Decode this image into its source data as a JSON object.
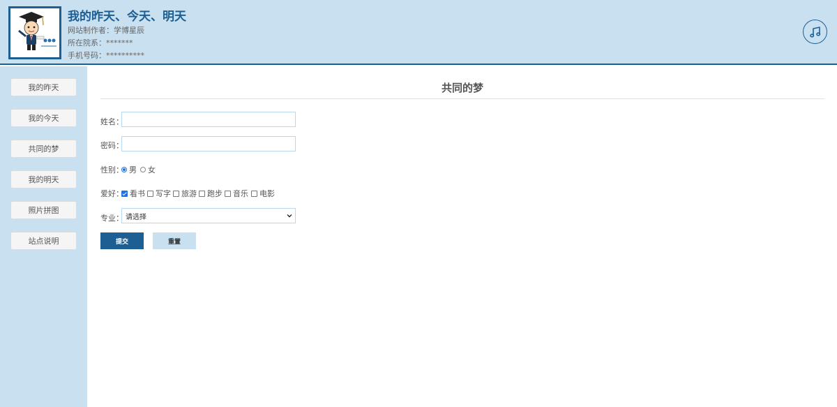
{
  "header": {
    "title": "我的昨天、今天、明天",
    "author": "网站制作者：学博星辰",
    "department": "所在院系：*******",
    "phone": "手机号码：**********",
    "music_icon": "music-note-icon"
  },
  "sidebar": {
    "items": [
      {
        "label": "我的昨天"
      },
      {
        "label": "我的今天"
      },
      {
        "label": "共同的梦"
      },
      {
        "label": "我的明天"
      },
      {
        "label": "照片拼图"
      },
      {
        "label": "站点说明"
      }
    ]
  },
  "form": {
    "title": "共同的梦",
    "name_label": "姓名：",
    "name_value": "",
    "password_label": "密码：",
    "password_value": "",
    "gender_label": "性别：",
    "gender_options": [
      {
        "label": "男",
        "selected": true
      },
      {
        "label": "女",
        "selected": false
      }
    ],
    "hobby_label": "爱好：",
    "hobbies": [
      {
        "label": "看书",
        "checked": true
      },
      {
        "label": "写字",
        "checked": false
      },
      {
        "label": "旅游",
        "checked": false
      },
      {
        "label": "跑步",
        "checked": false
      },
      {
        "label": "音乐",
        "checked": false
      },
      {
        "label": "电影",
        "checked": false
      }
    ],
    "major_label": "专业：",
    "major_selected": "请选择",
    "submit_label": "提交",
    "reset_label": "重置"
  },
  "colors": {
    "accent": "#1d5f93",
    "panel": "#c9e0f1"
  }
}
